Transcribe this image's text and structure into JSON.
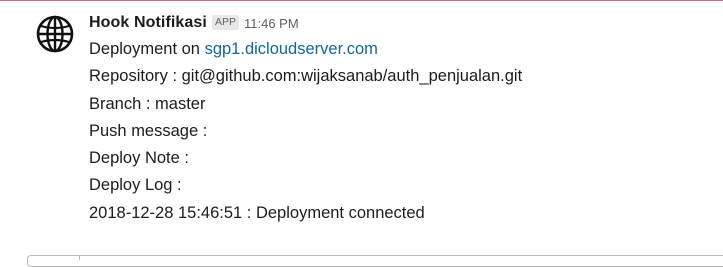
{
  "message": {
    "sender": "Hook Notifikasi",
    "badge": "APP",
    "time": "11:46 PM",
    "avatar_icon": "globe-icon",
    "lines": {
      "deployment_prefix": "Deployment on ",
      "deployment_host": "sgp1.dicloudserver.com",
      "repository": "Repository : git@github.com:wijaksanab/auth_penjualan.git",
      "branch": "Branch : master",
      "push_message": "Push message :",
      "deploy_note": "Deploy Note :",
      "deploy_log": "Deploy Log :",
      "log_entry": "2018-12-28 15:46:51 : Deployment connected"
    }
  },
  "colors": {
    "link": "#1264a3",
    "text": "#1d1c1d",
    "muted": "#616061",
    "badge_bg": "#e8e8e8",
    "top_rule": "#d36b7c"
  }
}
